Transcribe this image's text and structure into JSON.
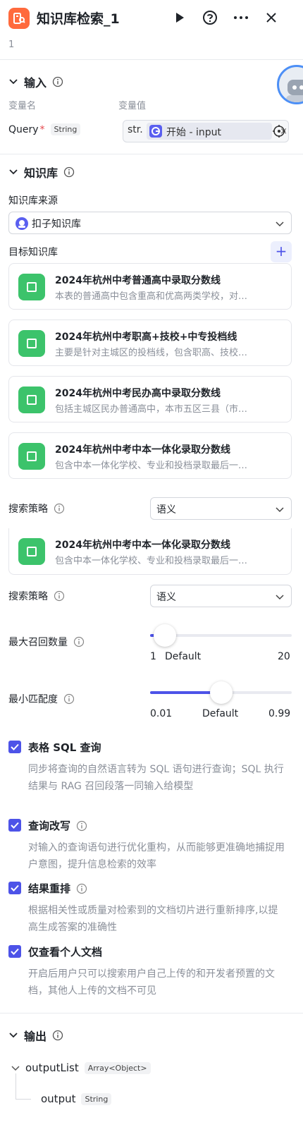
{
  "header": {
    "title": "知识库检索_1",
    "subtitle": "1",
    "icons": [
      "app-logo",
      "run-icon",
      "help-icon",
      "more-icon",
      "close-icon"
    ]
  },
  "input": {
    "section_title": "输入",
    "col_name": "变量名",
    "col_value": "变量值",
    "var_name": "Query",
    "required_mark": "*",
    "var_type": "String",
    "ref_prefix": "str.",
    "ref_text": "开始 - input",
    "clear_glyph": "×"
  },
  "knowledge": {
    "section_title": "知识库",
    "source_label": "知识库来源",
    "source_value": "扣子知识库",
    "target_label": "目标知识库",
    "add_glyph": "+",
    "items": [
      {
        "title": "2024年杭州中考普通高中录取分数线",
        "desc": "本表的普通高中包含重高和优高两类学校，对…"
      },
      {
        "title": "2024年杭州中考职高+技校+中专投档线",
        "desc": "主要是针对主城区的投档线，包含职高、技校…"
      },
      {
        "title": "2024年杭州中考民办高中录取分数线",
        "desc": "包括主城区民办普通高中，本市五区三县（市…"
      },
      {
        "title": "2024年杭州中考中本一体化录取分数线",
        "desc": "包含中本一体化学校、专业和投档录取最后一…"
      }
    ],
    "strategy_label": "搜索策略",
    "strategy_value": "语义",
    "overlay_item": {
      "title": "2024年杭州中考中本一体化录取分数线",
      "desc": "包含中本一体化学校、专业和投档录取最后一…"
    },
    "strategy_label_2": "搜索策略",
    "strategy_value_2": "语义"
  },
  "sliders": {
    "max_recall": {
      "label": "最大召回数量",
      "min": "1",
      "default_text": "Default",
      "max": "20",
      "value": 3
    },
    "min_match": {
      "label": "最小匹配度",
      "min": "0.01",
      "default_text": "Default",
      "max": "0.99",
      "value": 0.5
    }
  },
  "options": [
    {
      "title": "表格 SQL 查询",
      "desc": "同步将查询的自然语言转为 SQL 语句进行查询；SQL 执行结果与 RAG 召回段落一同输入给模型",
      "checked": true,
      "info": false
    },
    {
      "title": "查询改写",
      "desc": "对输入的查询语句进行优化重构，从而能够更准确地捕捉用户意图，提升信息检索的效率",
      "checked": true,
      "info": true
    },
    {
      "title": "结果重排",
      "desc": "根据相关性或质量对检索到的文档切片进行重新排序,以提高生成答案的准确性",
      "checked": true,
      "info": true
    },
    {
      "title": "仅查看个人文档",
      "desc": "开启后用户只可以搜索用户自己上传的和开发者预置的文档，其他人上传的文档不可见",
      "checked": true,
      "info": false
    }
  ],
  "output": {
    "section_title": "输出",
    "list_name": "outputList",
    "list_type": "Array<Object>",
    "child_name": "output",
    "child_type": "String"
  },
  "colors": {
    "accent": "#4d53e8",
    "kb_icon": "#3cc36b",
    "logo": "#ff6a3d"
  }
}
